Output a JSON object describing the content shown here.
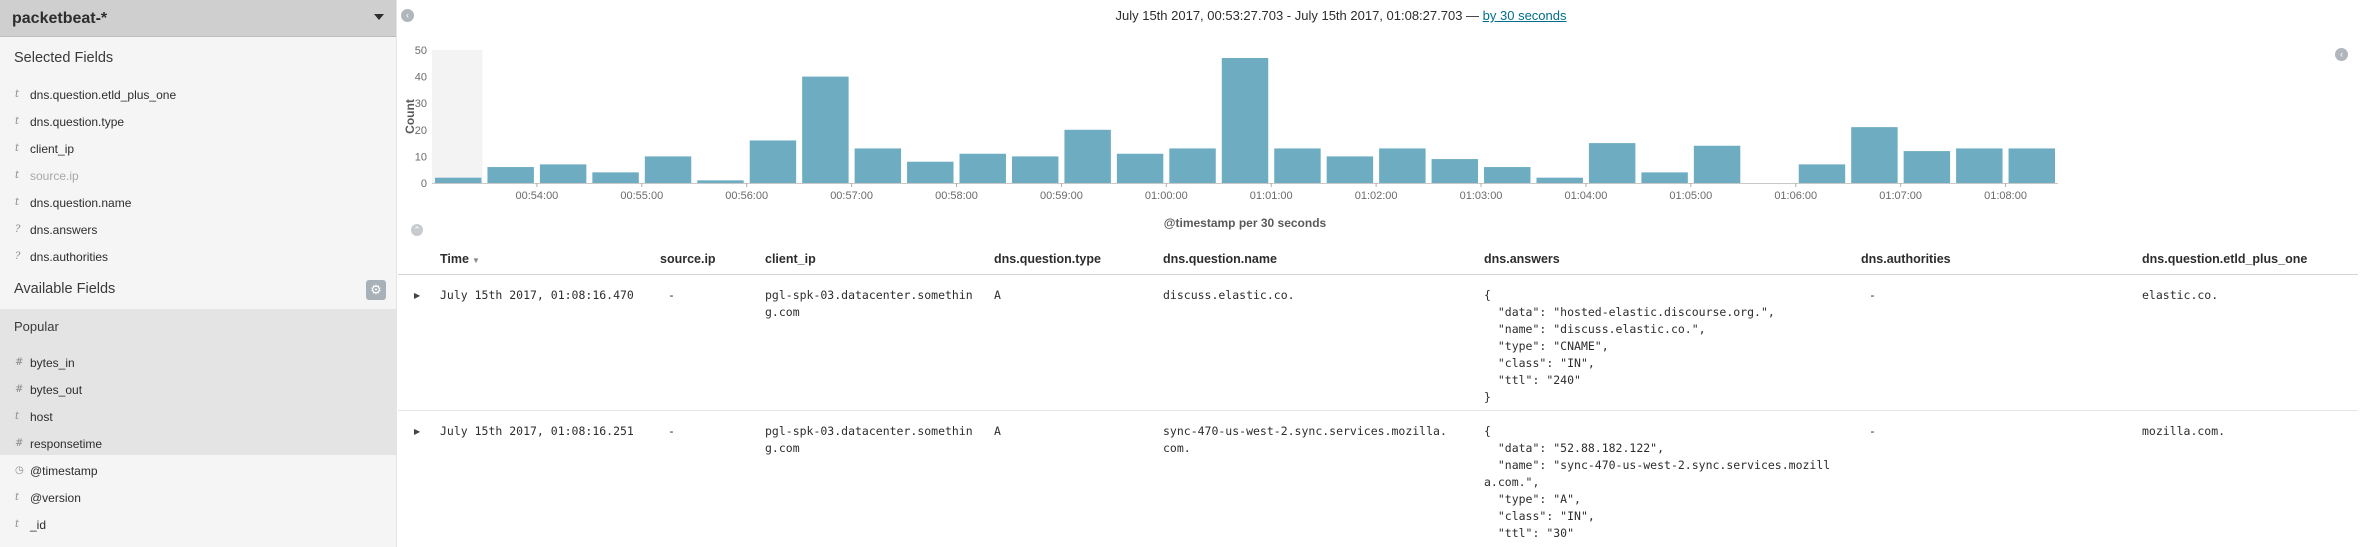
{
  "sidebar": {
    "index_pattern": "packetbeat-*",
    "selected_title": "Selected Fields",
    "selected_fields": [
      {
        "type": "t",
        "name": "dns.question.etld_plus_one"
      },
      {
        "type": "t",
        "name": "dns.question.type"
      },
      {
        "type": "t",
        "name": "client_ip"
      },
      {
        "type": "t",
        "name": "source.ip"
      },
      {
        "type": "t",
        "name": "dns.question.name"
      },
      {
        "type": "?",
        "name": "dns.answers"
      },
      {
        "type": "?",
        "name": "dns.authorities"
      }
    ],
    "available_title": "Available Fields",
    "popular_title": "Popular",
    "popular_fields": [
      {
        "type": "#",
        "name": "bytes_in"
      },
      {
        "type": "#",
        "name": "bytes_out"
      },
      {
        "type": "t",
        "name": "host"
      },
      {
        "type": "#",
        "name": "responsetime"
      }
    ],
    "other_fields": [
      {
        "type": "clock",
        "name": "@timestamp"
      },
      {
        "type": "t",
        "name": "@version"
      },
      {
        "type": "t",
        "name": "_id"
      }
    ]
  },
  "header": {
    "range_text": "July 15th 2017, 00:53:27.703 - July 15th 2017, 01:08:27.703 — ",
    "interval_link": "by 30 seconds"
  },
  "chart_data": {
    "type": "bar",
    "ylabel": "Count",
    "xlabel": "@timestamp per 30 seconds",
    "ylim": [
      0,
      50
    ],
    "yticks": [
      0,
      10,
      20,
      30,
      40,
      50
    ],
    "xticks": [
      "00:54:00",
      "00:55:00",
      "00:56:00",
      "00:57:00",
      "00:58:00",
      "00:59:00",
      "01:00:00",
      "01:01:00",
      "01:02:00",
      "01:03:00",
      "01:04:00",
      "01:05:00",
      "01:06:00",
      "01:07:00",
      "01:08:00"
    ],
    "values": [
      2,
      6,
      7,
      4,
      10,
      1,
      16,
      40,
      13,
      8,
      11,
      10,
      20,
      11,
      13,
      47,
      13,
      10,
      13,
      9,
      6,
      2,
      15,
      4,
      14,
      0,
      7,
      21,
      12,
      13,
      13
    ],
    "colors": {
      "bar": "#6eadc1",
      "partial_bucket": "#f3f3f3"
    }
  },
  "table": {
    "columns": [
      "Time",
      "source.ip",
      "client_ip",
      "dns.question.type",
      "dns.question.name",
      "dns.answers",
      "dns.authorities",
      "dns.question.etld_plus_one"
    ],
    "rows": [
      {
        "time": "July 15th 2017, 01:08:16.470",
        "source_ip": "-",
        "client_ip": "pgl-spk-03.datacenter.something.com",
        "qtype": "A",
        "qname": "discuss.elastic.co.",
        "answers": "{\n  \"data\": \"hosted-elastic.discourse.org.\",\n  \"name\": \"discuss.elastic.co.\",\n  \"type\": \"CNAME\",\n  \"class\": \"IN\",\n  \"ttl\": \"240\"\n}",
        "authorities": "-",
        "etld": "elastic.co."
      },
      {
        "time": "July 15th 2017, 01:08:16.251",
        "source_ip": "-",
        "client_ip": "pgl-spk-03.datacenter.something.com",
        "qtype": "A",
        "qname": "sync-470-us-west-2.sync.services.mozilla.com.",
        "answers": "{\n  \"data\": \"52.88.182.122\",\n  \"name\": \"sync-470-us-west-2.sync.services.mozilla.com.\",\n  \"type\": \"A\",\n  \"class\": \"IN\",\n  \"ttl\": \"30\"",
        "authorities": "-",
        "etld": "mozilla.com."
      }
    ]
  }
}
